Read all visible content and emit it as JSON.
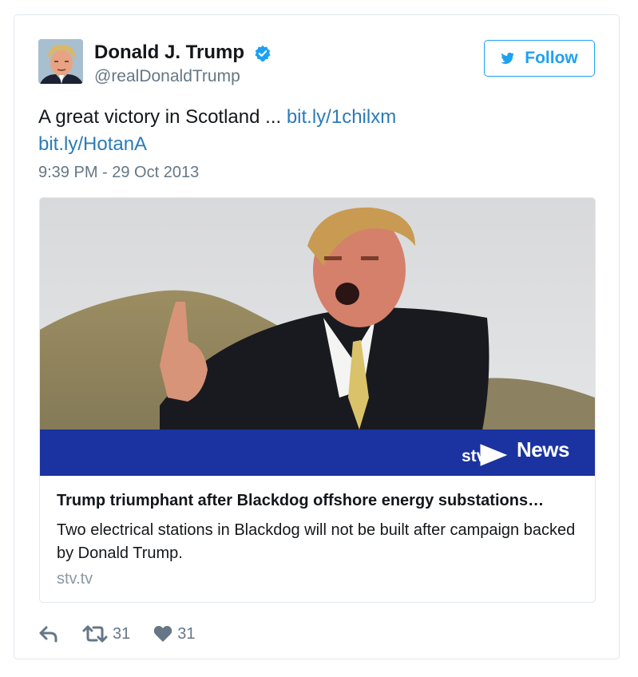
{
  "author": {
    "display_name": "Donald J. Trump",
    "handle": "@realDonaldTrump",
    "verified": true
  },
  "follow_button": {
    "label": "Follow"
  },
  "tweet": {
    "text": "A great victory in Scotland ... ",
    "link_1": "bit.ly/1chilxm",
    "link_2": "bit.ly/HotanA",
    "timestamp": "9:39 PM - 29 Oct 2013"
  },
  "card": {
    "brand_logo": "stv",
    "brand_label": "News",
    "title": "Trump triumphant after Blackdog offshore energy substations…",
    "description": "Two electrical stations in Blackdog will not be built after campaign backed by Donald Trump.",
    "domain": "stv.tv"
  },
  "actions": {
    "reply_icon": "reply-icon",
    "retweet_icon": "retweet-icon",
    "retweet_count": "31",
    "like_icon": "heart-icon",
    "like_count": "31"
  },
  "colors": {
    "link": "#2b7bb9",
    "follow": "#1da1f2",
    "secondary_text": "#657786",
    "news_bar": "#1a33a0"
  }
}
